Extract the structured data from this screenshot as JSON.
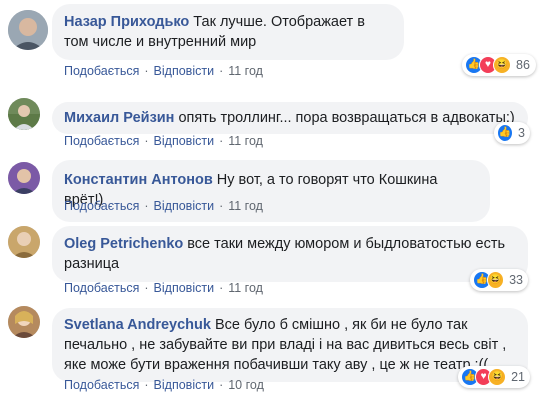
{
  "action_labels": {
    "like": "Подобається",
    "reply": "Відповісти",
    "separator": "·"
  },
  "comments": [
    {
      "author": "Назар Приходько",
      "text": "Так лучше. Отображает в том числе и внутренний мир",
      "time": "11 год",
      "reactions": {
        "icons": [
          "like-icon",
          "love-icon",
          "haha-icon"
        ],
        "count": "86"
      }
    },
    {
      "author": "Михаил Рейзин",
      "text": "опять троллинг... пора возвращаться в адвокаты:)",
      "time": "11 год",
      "reactions": {
        "icons": [
          "like-icon"
        ],
        "count": "3"
      }
    },
    {
      "author": "Константин Антонов",
      "text": "Ну вот, а то говорят что Кошкина врёт!)",
      "time": "11 год",
      "reactions": null
    },
    {
      "author": "Oleg Petrichenko",
      "text": "все таки между юмором и быдловатостью есть разница",
      "time": "11 год",
      "reactions": {
        "icons": [
          "like-icon",
          "haha-icon"
        ],
        "count": "33"
      }
    },
    {
      "author": "Svetlana Andreychuk",
      "text": "Все було б смішно , як би не було так печально , не забувайте ви при владі і на вас дивиться весь світ , яке може бути враження побачивши таку аву , це ж не театр :((",
      "time": "10 год",
      "reactions": {
        "icons": [
          "like-icon",
          "love-icon",
          "haha-icon"
        ],
        "count": "21"
      }
    }
  ],
  "colors": {
    "author": "#385898",
    "bubble": "#f2f3f5",
    "like": "#1877f2",
    "love": "#f33e58",
    "haha": "#f7b125"
  }
}
